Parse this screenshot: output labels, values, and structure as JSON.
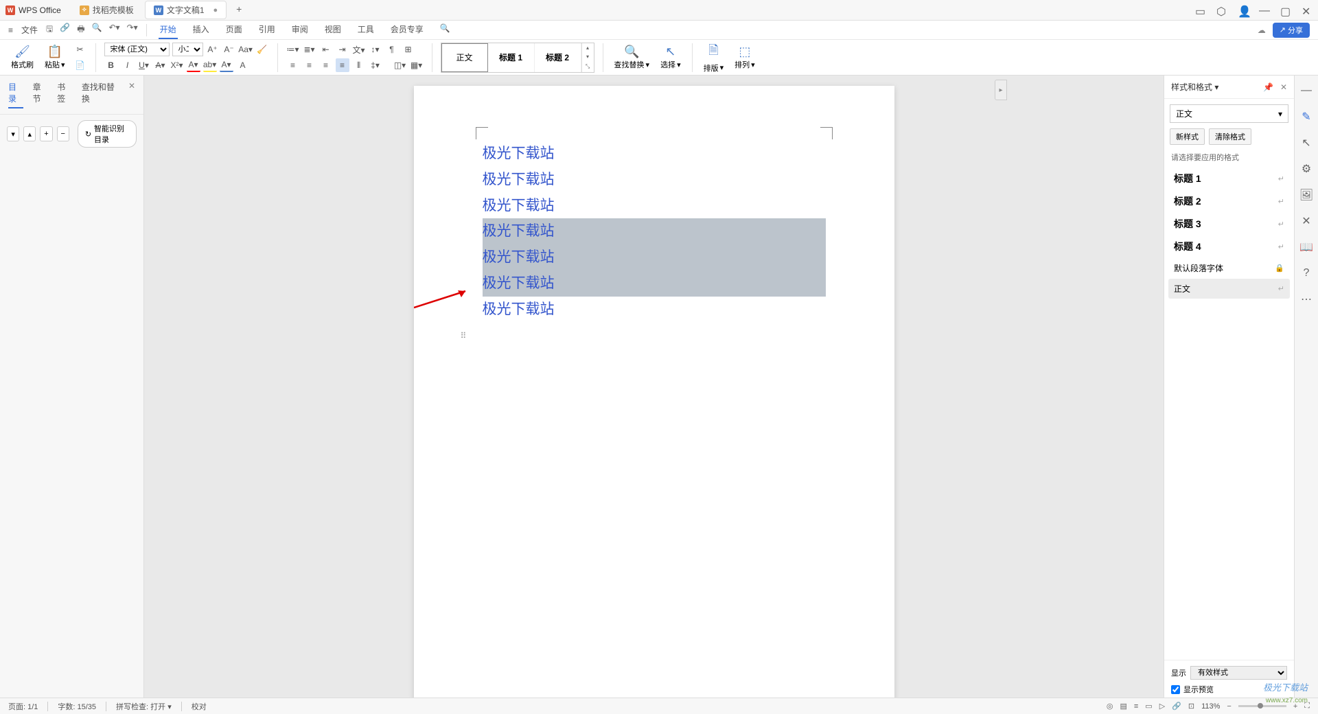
{
  "app": {
    "name": "WPS Office"
  },
  "tabs": [
    {
      "label": "找稻壳模板",
      "icon": "yellow"
    },
    {
      "label": "文字文稿1",
      "icon": "blue",
      "active": true
    }
  ],
  "quickbar": {
    "file": "文件"
  },
  "menu": {
    "items": [
      "开始",
      "插入",
      "页面",
      "引用",
      "审阅",
      "视图",
      "工具",
      "会员专享"
    ],
    "active": 0
  },
  "share": "分享",
  "ribbon": {
    "format_painter": "格式刷",
    "paste": "粘贴",
    "font_name": "宋体 (正文)",
    "font_size": "小二",
    "style_items": [
      "正文",
      "标题 1",
      "标题 2"
    ],
    "find_replace": "查找替换",
    "select": "选择",
    "layout": "排版",
    "arrange": "排列"
  },
  "left_panel": {
    "tabs": [
      "目录",
      "章节",
      "书签",
      "查找和替换"
    ],
    "active": 0,
    "smart": "智能识别目录"
  },
  "document": {
    "lines": [
      "极光下载站",
      "极光下载站",
      "极光下载站",
      "极光下载站",
      "极光下载站",
      "极光下载站",
      "极光下载站"
    ],
    "selected_start": 3,
    "selected_end": 5
  },
  "right_panel": {
    "title": "样式和格式",
    "current_style": "正文",
    "btn_new": "新样式",
    "btn_clear": "清除格式",
    "hint": "请选择要应用的格式",
    "styles": [
      {
        "label": "标题 1",
        "bold": true
      },
      {
        "label": "标题 2",
        "bold": true
      },
      {
        "label": "标题 3",
        "bold": true
      },
      {
        "label": "标题 4",
        "bold": true
      },
      {
        "label": "默认段落字体",
        "small": true,
        "lock": true
      },
      {
        "label": "正文",
        "small": true,
        "selected": true
      }
    ],
    "show_label": "显示",
    "show_value": "有效样式",
    "preview": "显示预览"
  },
  "statusbar": {
    "page": "页面: 1/1",
    "words": "字数: 15/35",
    "spell": "拼写检查: 打开",
    "proof": "校对",
    "zoom": "113%"
  },
  "watermark": "极光下载站",
  "watermark2": "www.xz7.com"
}
